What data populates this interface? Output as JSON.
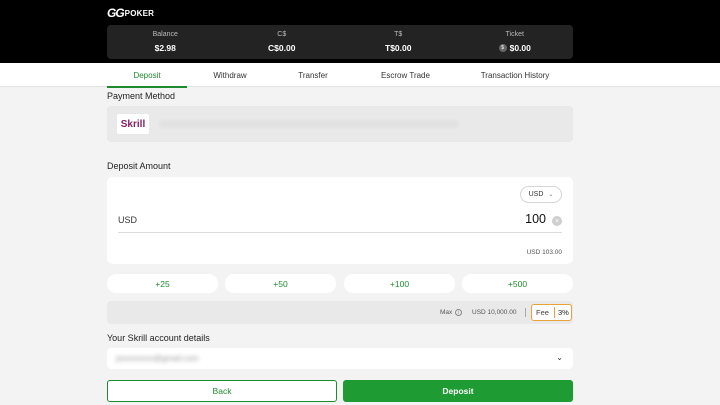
{
  "brand": {
    "logo_gg": "GG",
    "logo_text": "POKER"
  },
  "balances": [
    {
      "label": "Balance",
      "value": "$2.98"
    },
    {
      "label": "C$",
      "value": "C$0.00"
    },
    {
      "label": "T$",
      "value": "T$0.00"
    },
    {
      "label": "Ticket",
      "value": "$0.00",
      "icon": "ticket-coin-icon"
    }
  ],
  "tabs": [
    {
      "label": "Deposit",
      "active": true
    },
    {
      "label": "Withdraw",
      "active": false
    },
    {
      "label": "Transfer",
      "active": false
    },
    {
      "label": "Escrow Trade",
      "active": false
    },
    {
      "label": "Transaction History",
      "active": false
    }
  ],
  "payment_method": {
    "title": "Payment Method",
    "provider": "Skrill"
  },
  "deposit_amount": {
    "title": "Deposit Amount",
    "currency_select": "USD",
    "currency_label": "USD",
    "amount": "100",
    "total": "USD 103.00"
  },
  "quick_amounts": [
    "+25",
    "+50",
    "+100",
    "+500"
  ],
  "limits": {
    "max_label": "Max",
    "max_value": "USD 10,000.00",
    "fee_label": "Fee",
    "fee_value": "3%"
  },
  "account": {
    "title": "Your Skrill account details",
    "email": "jsxxxxxxxx@gmail.com"
  },
  "buttons": {
    "back": "Back",
    "deposit": "Deposit"
  },
  "colors": {
    "accent": "#1e8a2e",
    "fee_border": "#e8a23a",
    "skrill": "#862165"
  }
}
